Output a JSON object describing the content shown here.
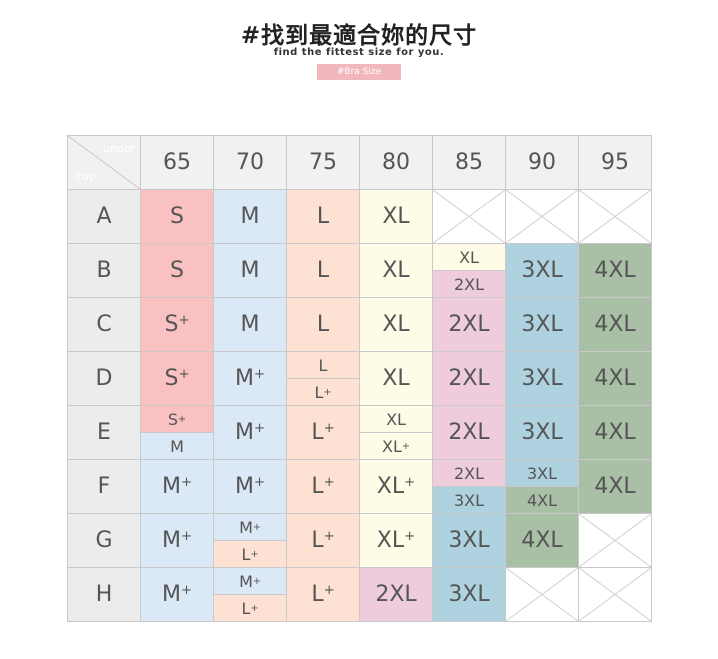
{
  "header": {
    "title": "#找到最適合妳的尺寸",
    "subtitle": "find the fittest size for you.",
    "tag": "#Bra Size"
  },
  "table": {
    "corner_under": "under",
    "corner_cup": "cup",
    "columns": [
      "65",
      "70",
      "75",
      "80",
      "85",
      "90",
      "95"
    ],
    "rows": [
      "A",
      "B",
      "C",
      "D",
      "E",
      "F",
      "G",
      "H"
    ],
    "cells": {
      "A": [
        "S",
        "M",
        "L",
        "XL",
        "",
        "",
        ""
      ],
      "B": [
        "S",
        "M",
        "L",
        "XL",
        "XL / 2XL",
        "3XL",
        "4XL"
      ],
      "C": [
        "S+",
        "M",
        "L",
        "XL",
        "2XL",
        "3XL",
        "4XL"
      ],
      "D": [
        "S+",
        "M+",
        "L / L+",
        "XL",
        "2XL",
        "3XL",
        "4XL"
      ],
      "E": [
        "S+ / M",
        "M+",
        "L+",
        "XL / XL+",
        "2XL",
        "3XL",
        "4XL"
      ],
      "F": [
        "M+",
        "M+",
        "L+",
        "XL+",
        "2XL / 3XL",
        "3XL / 4XL",
        "4XL"
      ],
      "G": [
        "M+",
        "M+ / L+",
        "L+",
        "XL+",
        "3XL",
        "4XL",
        ""
      ],
      "H": [
        "M+",
        "M+ / L+",
        "L+",
        "2XL",
        "3XL",
        "",
        ""
      ]
    },
    "size_colors": {
      "S": "#f9c1c1",
      "M": "#dbe9f7",
      "L": "#fde2d3",
      "XL": "#fefbe7",
      "2XL": "#eeccdc",
      "3XL": "#aed2df",
      "4XL": "#a9bfa6"
    }
  }
}
